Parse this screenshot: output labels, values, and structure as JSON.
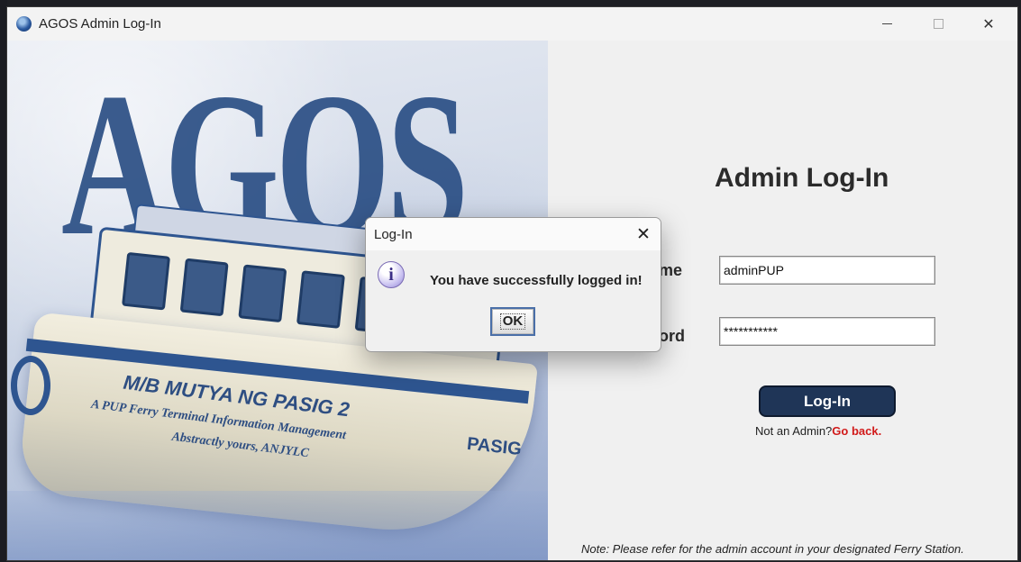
{
  "window": {
    "title": "AGOS Admin Log-In",
    "controls": {
      "minimize": "minimize",
      "maximize": "maximize",
      "close": "✕"
    }
  },
  "hero": {
    "logo_text": "AGOS",
    "boat_name": "M/B MUTYA NG PASIG 2",
    "boat_subtitle": "A PUP Ferry Terminal Information Management",
    "boat_signature": "Abstractly yours, ANJYLC",
    "boat_mark": "PASIG"
  },
  "login": {
    "heading": "Admin Log-In",
    "username_label": "Username",
    "username_value": "adminPUP",
    "password_label": "Password",
    "password_value": "***********",
    "login_button": "Log-In",
    "not_admin_text": "Not an Admin?",
    "go_back_link": "Go back.",
    "note": "Note: Please refer for the admin account in your designated Ferry Station."
  },
  "dialog": {
    "title": "Log-In",
    "close_glyph": "✕",
    "icon": "info-icon",
    "icon_glyph": "i",
    "message": "You have successfully logged in!",
    "ok_label": "OK"
  },
  "colors": {
    "accent_button": "#1f3557",
    "link_red": "#d11a1a",
    "hero_blue": "#2b4f85"
  }
}
